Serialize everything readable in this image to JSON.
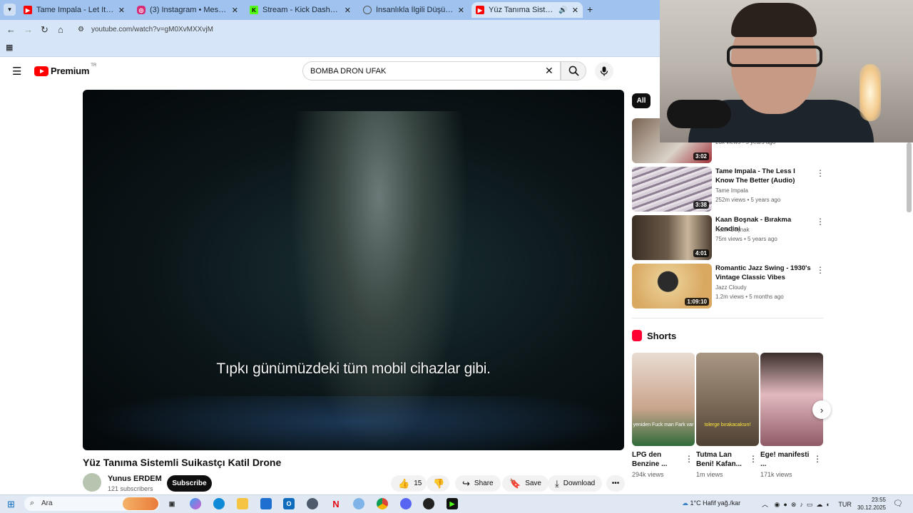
{
  "browser": {
    "tabs": [
      {
        "title": "Tame Impala - Let It Happen (O",
        "favicon": "youtube-icon",
        "color": "#ff0000"
      },
      {
        "title": "(3) Instagram • Mesajlar",
        "favicon": "instagram-icon",
        "color": "#d62976"
      },
      {
        "title": "Stream - Kick Dashboard",
        "favicon": "kick-icon",
        "color": "#53fc18"
      },
      {
        "title": "İnsanlıkla İlgili Düşünceler",
        "favicon": "globe-icon",
        "color": "#555555"
      },
      {
        "title": "Yüz Tanıma Sistemli Suikastçı",
        "favicon": "youtube-icon",
        "color": "#ff0000"
      }
    ],
    "new_tab": "+",
    "url": "youtube.com/watch?v=gM0XvMXXvjM"
  },
  "youtube": {
    "logo_text": "Premium",
    "logo_region": "TR",
    "search_query": "BOMBA DRON UFAK"
  },
  "video": {
    "subtitle": "Tıpkı günümüzdeki tüm mobil cihazlar gibi.",
    "title": "Yüz Tanıma Sistemli Suikastçı Katil Drone",
    "channel": "Yunus ERDEM",
    "subscribers": "121 subscribers",
    "subscribe_label": "Subscribe",
    "likes": "15",
    "share_label": "Share",
    "save_label": "Save",
    "download_label": "Download"
  },
  "sidebar": {
    "chip_all": "All",
    "recommendations": [
      {
        "title": "",
        "channel": "",
        "meta": "23k views • 5 years ago",
        "duration": "3:02",
        "thumb_color": "#6b5a4a"
      },
      {
        "title": "Tame Impala - The Less I Know The Better (Audio)",
        "channel": "Tame Impala",
        "meta": "252m views • 5 years ago",
        "duration": "3:38",
        "thumb_color": "#b7b0b8"
      },
      {
        "title": "Kaan Boşnak - Bırakma Kendini",
        "channel": "Kaan Boşnak",
        "meta": "75m views • 5 years ago",
        "duration": "4:01",
        "thumb_color": "#5a4a3c"
      },
      {
        "title": "Romantic Jazz Swing - 1930's Vintage Classic Vibes",
        "channel": "Jazz Cloudy",
        "meta": "1.2m views • 5 months ago",
        "duration": "1:09:10",
        "thumb_color": "#e9c98e"
      }
    ],
    "shorts_title": "Shorts",
    "shorts": [
      {
        "title": "LPG den Benzine ...",
        "views": "294k views",
        "caption": "yeniden Fuck man Fark var",
        "color": "#c9a48c"
      },
      {
        "title": "Tutma Lan Beni! Kafan...",
        "views": "1m views",
        "caption": "tolerge bırakacaksın!",
        "color": "#7c6a58"
      },
      {
        "title": "Ege! manifesti ...",
        "views": "171k views",
        "caption": "",
        "color": "#e2b9bf"
      }
    ]
  },
  "taskbar": {
    "search_label": "Ara",
    "weather": "1°C  Hafif yağ./kar",
    "language": "TUR",
    "time": "23:55",
    "date": "30.12.2025"
  }
}
